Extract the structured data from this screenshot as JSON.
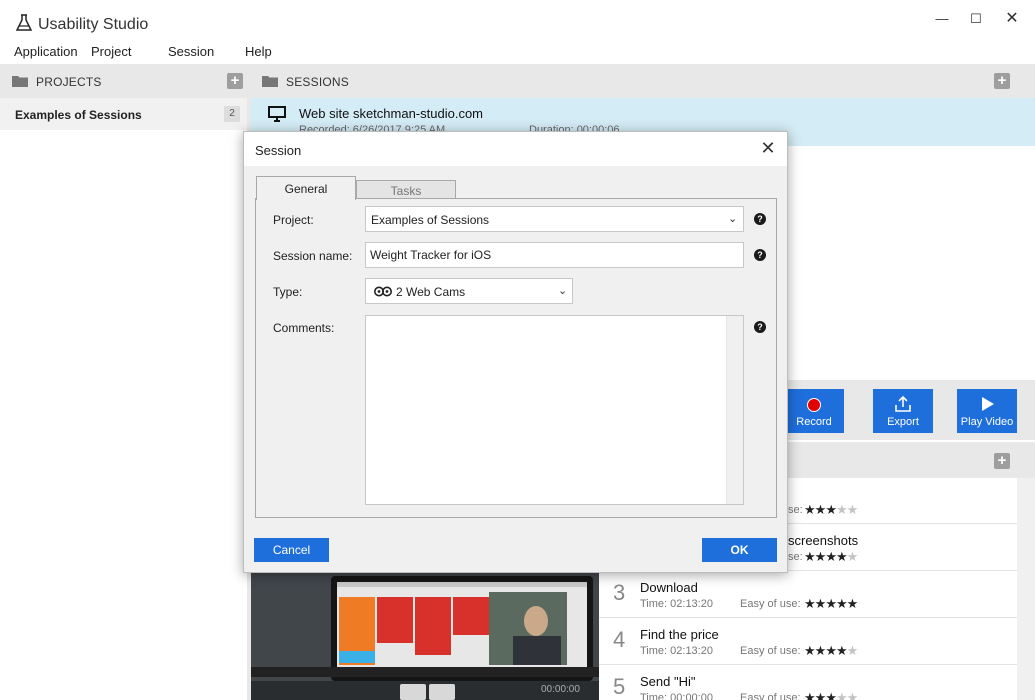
{
  "app": {
    "title": "Usability Studio"
  },
  "window": {
    "minimize": "—",
    "maximize": "☐",
    "close": "✕"
  },
  "menu": [
    "Application",
    "Project",
    "Session",
    "Help"
  ],
  "projects": {
    "header": "PROJECTS",
    "items": [
      {
        "label": "Examples of Sessions",
        "count": "2"
      }
    ]
  },
  "sessions": {
    "header": "SESSIONS",
    "selected": {
      "title": "Web site sketchman-studio.com",
      "recorded": "Recorded:   6/26/2017 9:25 AM",
      "duration": "Duration:   00:00:06"
    }
  },
  "toolbar": {
    "record": "Record",
    "export": "Export",
    "play": "Play Video"
  },
  "tasks": [
    {
      "num": "",
      "name": "",
      "time": "",
      "ease": "se:",
      "rating": 3
    },
    {
      "num": "",
      "name": "screenshots",
      "time": "",
      "ease": "se:",
      "rating": 4
    },
    {
      "num": "3",
      "name": "Download",
      "time": "Time: 02:13:20",
      "ease": "Easy of use:",
      "rating": 5
    },
    {
      "num": "4",
      "name": "Find the price",
      "time": "Time: 02:13:20",
      "ease": "Easy of use:",
      "rating": 4
    },
    {
      "num": "5",
      "name": "Send \"Hi\"",
      "time": "Time: 00:00:00",
      "ease": "Easy of use:",
      "rating": 3
    }
  ],
  "video": {
    "time": "00:00:00"
  },
  "dialog": {
    "title": "Session",
    "tabs": {
      "general": "General",
      "tasks": "Tasks"
    },
    "project_label": "Project:",
    "project_value": "Examples of Sessions",
    "name_label": "Session name:",
    "name_value": "Weight Tracker for iOS",
    "type_label": "Type:",
    "type_value": "2 Web Cams",
    "comments_label": "Comments:",
    "comments_value": "",
    "help": "?",
    "cancel": "Cancel",
    "ok": "OK"
  },
  "colors": {
    "accent": "#1e6fdc",
    "selected_row": "#d4ecf6",
    "record_dot": "#e00000"
  }
}
